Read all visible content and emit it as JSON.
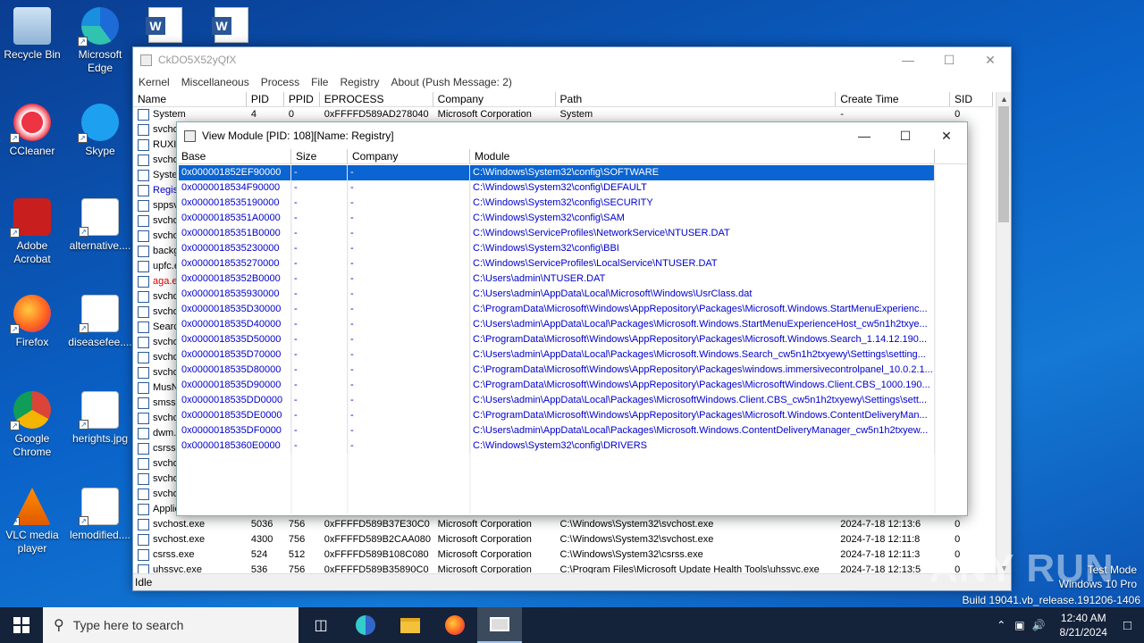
{
  "desktop": {
    "icons": [
      {
        "label": "Recycle Bin"
      },
      {
        "label": "Microsoft Edge"
      },
      {
        "label": "CCleaner"
      },
      {
        "label": "Skype"
      },
      {
        "label": "Adobe Acrobat"
      },
      {
        "label": "alternative...."
      },
      {
        "label": "Firefox"
      },
      {
        "label": "diseasefee...."
      },
      {
        "label": "Google Chrome"
      },
      {
        "label": "herights.jpg"
      },
      {
        "label": "VLC media player"
      },
      {
        "label": "lemodified...."
      }
    ]
  },
  "main_window": {
    "title": "CkDO5X52yQfX",
    "menu": [
      "Kernel",
      "Miscellaneous",
      "Process",
      "File",
      "Registry",
      "About (Push Message: 2)"
    ],
    "columns": [
      "Name",
      "PID",
      "PPID",
      "EPROCESS",
      "Company",
      "Path",
      "Create Time",
      "SID"
    ],
    "rows_top": [
      {
        "name": "System",
        "pid": "4",
        "ppid": "0",
        "eprocess": "0xFFFFD589AD278040",
        "company": "Microsoft Corporation",
        "path": "System",
        "time": "-",
        "sid": "0"
      }
    ],
    "partial_names": [
      "svcho",
      "RUXIN",
      "svcho",
      "Syster",
      "Regist",
      "sppsv",
      "svcho",
      "svcho",
      "backg",
      "upfc.e",
      "aga.ex",
      "svcho",
      "svcho",
      "Searc",
      "svcho",
      "svcho",
      "svcho",
      "MusN",
      "smss.e",
      "svcho",
      "dwm.e",
      "csrss.",
      "svcho",
      "svcho",
      "svcho",
      "Applic"
    ],
    "rows_bottom": [
      {
        "name": "svchost.exe",
        "pid": "5036",
        "ppid": "756",
        "eprocess": "0xFFFFD589B37E30C0",
        "company": "Microsoft Corporation",
        "path": "C:\\Windows\\System32\\svchost.exe",
        "time": "2024-7-18 12:13:6",
        "sid": "0"
      },
      {
        "name": "svchost.exe",
        "pid": "4300",
        "ppid": "756",
        "eprocess": "0xFFFFD589B2CAA080",
        "company": "Microsoft Corporation",
        "path": "C:\\Windows\\System32\\svchost.exe",
        "time": "2024-7-18 12:11:8",
        "sid": "0"
      },
      {
        "name": "csrss.exe",
        "pid": "524",
        "ppid": "512",
        "eprocess": "0xFFFFD589B108C080",
        "company": "Microsoft Corporation",
        "path": "C:\\Windows\\System32\\csrss.exe",
        "time": "2024-7-18 12:11:3",
        "sid": "0"
      },
      {
        "name": "uhssvc.exe",
        "pid": "536",
        "ppid": "756",
        "eprocess": "0xFFFFD589B35890C0",
        "company": "Microsoft Corporation",
        "path": "C:\\Program Files\\Microsoft Update Health Tools\\uhssvc.exe",
        "time": "2024-7-18 12:13:5",
        "sid": "0"
      }
    ],
    "status": "Idle"
  },
  "module_dialog": {
    "title": "View Module [PID: 108][Name: Registry]",
    "columns": [
      "Base",
      "Size",
      "Company",
      "Module"
    ],
    "rows": [
      {
        "base": "0x000001852EF90000",
        "size": "-",
        "company": "-",
        "module": "C:\\Windows\\System32\\config\\SOFTWARE"
      },
      {
        "base": "0x0000018534F90000",
        "size": "-",
        "company": "-",
        "module": "C:\\Windows\\System32\\config\\DEFAULT"
      },
      {
        "base": "0x0000018535190000",
        "size": "-",
        "company": "-",
        "module": "C:\\Windows\\System32\\config\\SECURITY"
      },
      {
        "base": "0x00000185351A0000",
        "size": "-",
        "company": "-",
        "module": "C:\\Windows\\System32\\config\\SAM"
      },
      {
        "base": "0x00000185351B0000",
        "size": "-",
        "company": "-",
        "module": "C:\\Windows\\ServiceProfiles\\NetworkService\\NTUSER.DAT"
      },
      {
        "base": "0x0000018535230000",
        "size": "-",
        "company": "-",
        "module": "C:\\Windows\\System32\\config\\BBI"
      },
      {
        "base": "0x0000018535270000",
        "size": "-",
        "company": "-",
        "module": "C:\\Windows\\ServiceProfiles\\LocalService\\NTUSER.DAT"
      },
      {
        "base": "0x00000185352B0000",
        "size": "-",
        "company": "-",
        "module": "C:\\Users\\admin\\NTUSER.DAT"
      },
      {
        "base": "0x0000018535930000",
        "size": "-",
        "company": "-",
        "module": "C:\\Users\\admin\\AppData\\Local\\Microsoft\\Windows\\UsrClass.dat"
      },
      {
        "base": "0x0000018535D30000",
        "size": "-",
        "company": "-",
        "module": "C:\\ProgramData\\Microsoft\\Windows\\AppRepository\\Packages\\Microsoft.Windows.StartMenuExperienc..."
      },
      {
        "base": "0x0000018535D40000",
        "size": "-",
        "company": "-",
        "module": "C:\\Users\\admin\\AppData\\Local\\Packages\\Microsoft.Windows.StartMenuExperienceHost_cw5n1h2txye..."
      },
      {
        "base": "0x0000018535D50000",
        "size": "-",
        "company": "-",
        "module": "C:\\ProgramData\\Microsoft\\Windows\\AppRepository\\Packages\\Microsoft.Windows.Search_1.14.12.190..."
      },
      {
        "base": "0x0000018535D70000",
        "size": "-",
        "company": "-",
        "module": "C:\\Users\\admin\\AppData\\Local\\Packages\\Microsoft.Windows.Search_cw5n1h2txyewy\\Settings\\setting..."
      },
      {
        "base": "0x0000018535D80000",
        "size": "-",
        "company": "-",
        "module": "C:\\ProgramData\\Microsoft\\Windows\\AppRepository\\Packages\\windows.immersivecontrolpanel_10.0.2.1..."
      },
      {
        "base": "0x0000018535D90000",
        "size": "-",
        "company": "-",
        "module": "C:\\ProgramData\\Microsoft\\Windows\\AppRepository\\Packages\\MicrosoftWindows.Client.CBS_1000.190..."
      },
      {
        "base": "0x0000018535DD0000",
        "size": "-",
        "company": "-",
        "module": "C:\\Users\\admin\\AppData\\Local\\Packages\\MicrosoftWindows.Client.CBS_cw5n1h2txyewy\\Settings\\sett..."
      },
      {
        "base": "0x0000018535DE0000",
        "size": "-",
        "company": "-",
        "module": "C:\\ProgramData\\Microsoft\\Windows\\AppRepository\\Packages\\Microsoft.Windows.ContentDeliveryMan..."
      },
      {
        "base": "0x0000018535DF0000",
        "size": "-",
        "company": "-",
        "module": "C:\\Users\\admin\\AppData\\Local\\Packages\\Microsoft.Windows.ContentDeliveryManager_cw5n1h2txyew..."
      },
      {
        "base": "0x00000185360E0000",
        "size": "-",
        "company": "-",
        "module": "C:\\Windows\\System32\\config\\DRIVERS"
      }
    ]
  },
  "watermark": {
    "brand": "ANY RUN",
    "line1": "Test Mode",
    "line2": "Windows 10 Pro",
    "line3": "Build 19041.vb_release.191206-1406"
  },
  "taskbar": {
    "search_placeholder": "Type here to search",
    "time": "12:40 AM",
    "date": "8/21/2024"
  },
  "colors": {
    "selection": "#0a64d2",
    "module_text": "#0000cc",
    "taskbar": "#14223a"
  }
}
